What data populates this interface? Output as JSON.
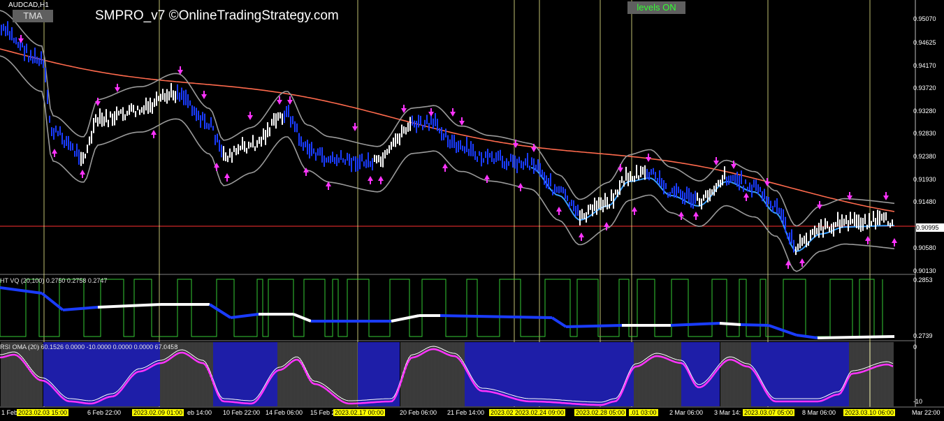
{
  "symbol": "AUDCAD,H1",
  "buttons": {
    "tma": "TMA",
    "levels": "levels ON"
  },
  "title": "SMPRO_v7 ©OnlineTradingStrategy.com",
  "price_axis": [
    "0.95070",
    "0.94625",
    "0.94170",
    "0.93720",
    "0.93280",
    "0.92830",
    "0.92380",
    "0.91930",
    "0.91480",
    "0.90580",
    "0.90130"
  ],
  "current_price": "0.90995",
  "indicator1": {
    "label": "HT VQ (20,100) 0.2750 0.2758 0.2747",
    "scale_top": "0.2853",
    "scale_bottom": "0.2739"
  },
  "indicator2": {
    "label": "RSI OMA (20) 60.1526 0.0000 -10.0000 0.0000 0.0000 67.0458",
    "scale_top": "0",
    "scale_bottom": "-10"
  },
  "time_axis": [
    {
      "text": "1 Feb",
      "hl": false
    },
    {
      "text": "2023.02.03 15:00",
      "hl": true
    },
    {
      "text": "6 Feb 22:00",
      "hl": false
    },
    {
      "text": "2023.02.09 01:00",
      "hl": true
    },
    {
      "text": "eb 14:00",
      "hl": false
    },
    {
      "text": "10 Feb 22:00",
      "hl": false
    },
    {
      "text": "14 Feb 06:00",
      "hl": false
    },
    {
      "text": "15 Feb 22:00",
      "hl": false
    },
    {
      "text": "2023.02.17 00:00",
      "hl": true
    },
    {
      "text": "20 Feb 06:00",
      "hl": false
    },
    {
      "text": "21 Feb 14:00",
      "hl": false
    },
    {
      "text": "2023.02",
      "hl": true
    },
    {
      "text": "2023.02.24 09:00",
      "hl": true
    },
    {
      "text": "2023.02.28 05:00",
      "hl": true
    },
    {
      "text": ".01 03:00",
      "hl": true
    },
    {
      "text": "2 Mar 06:00",
      "hl": false
    },
    {
      "text": "3 Mar 14:",
      "hl": false
    },
    {
      "text": "2023.03.07 05:00",
      "hl": true
    },
    {
      "text": "8 Mar 06:00",
      "hl": false
    },
    {
      "text": "2023.03.10 06:00",
      "hl": true
    },
    {
      "text": "Mar 22:00",
      "hl": false
    }
  ],
  "colors": {
    "ma_red": "#ff6a4d",
    "band_gray": "#9a9a9a",
    "bull": "#ffffff",
    "bear": "#1a3cff",
    "arrow": "#ff33ff",
    "vline": "#ffff99",
    "grid_green": "#33cc33",
    "rsi_bar": "#1e1ea8"
  }
}
